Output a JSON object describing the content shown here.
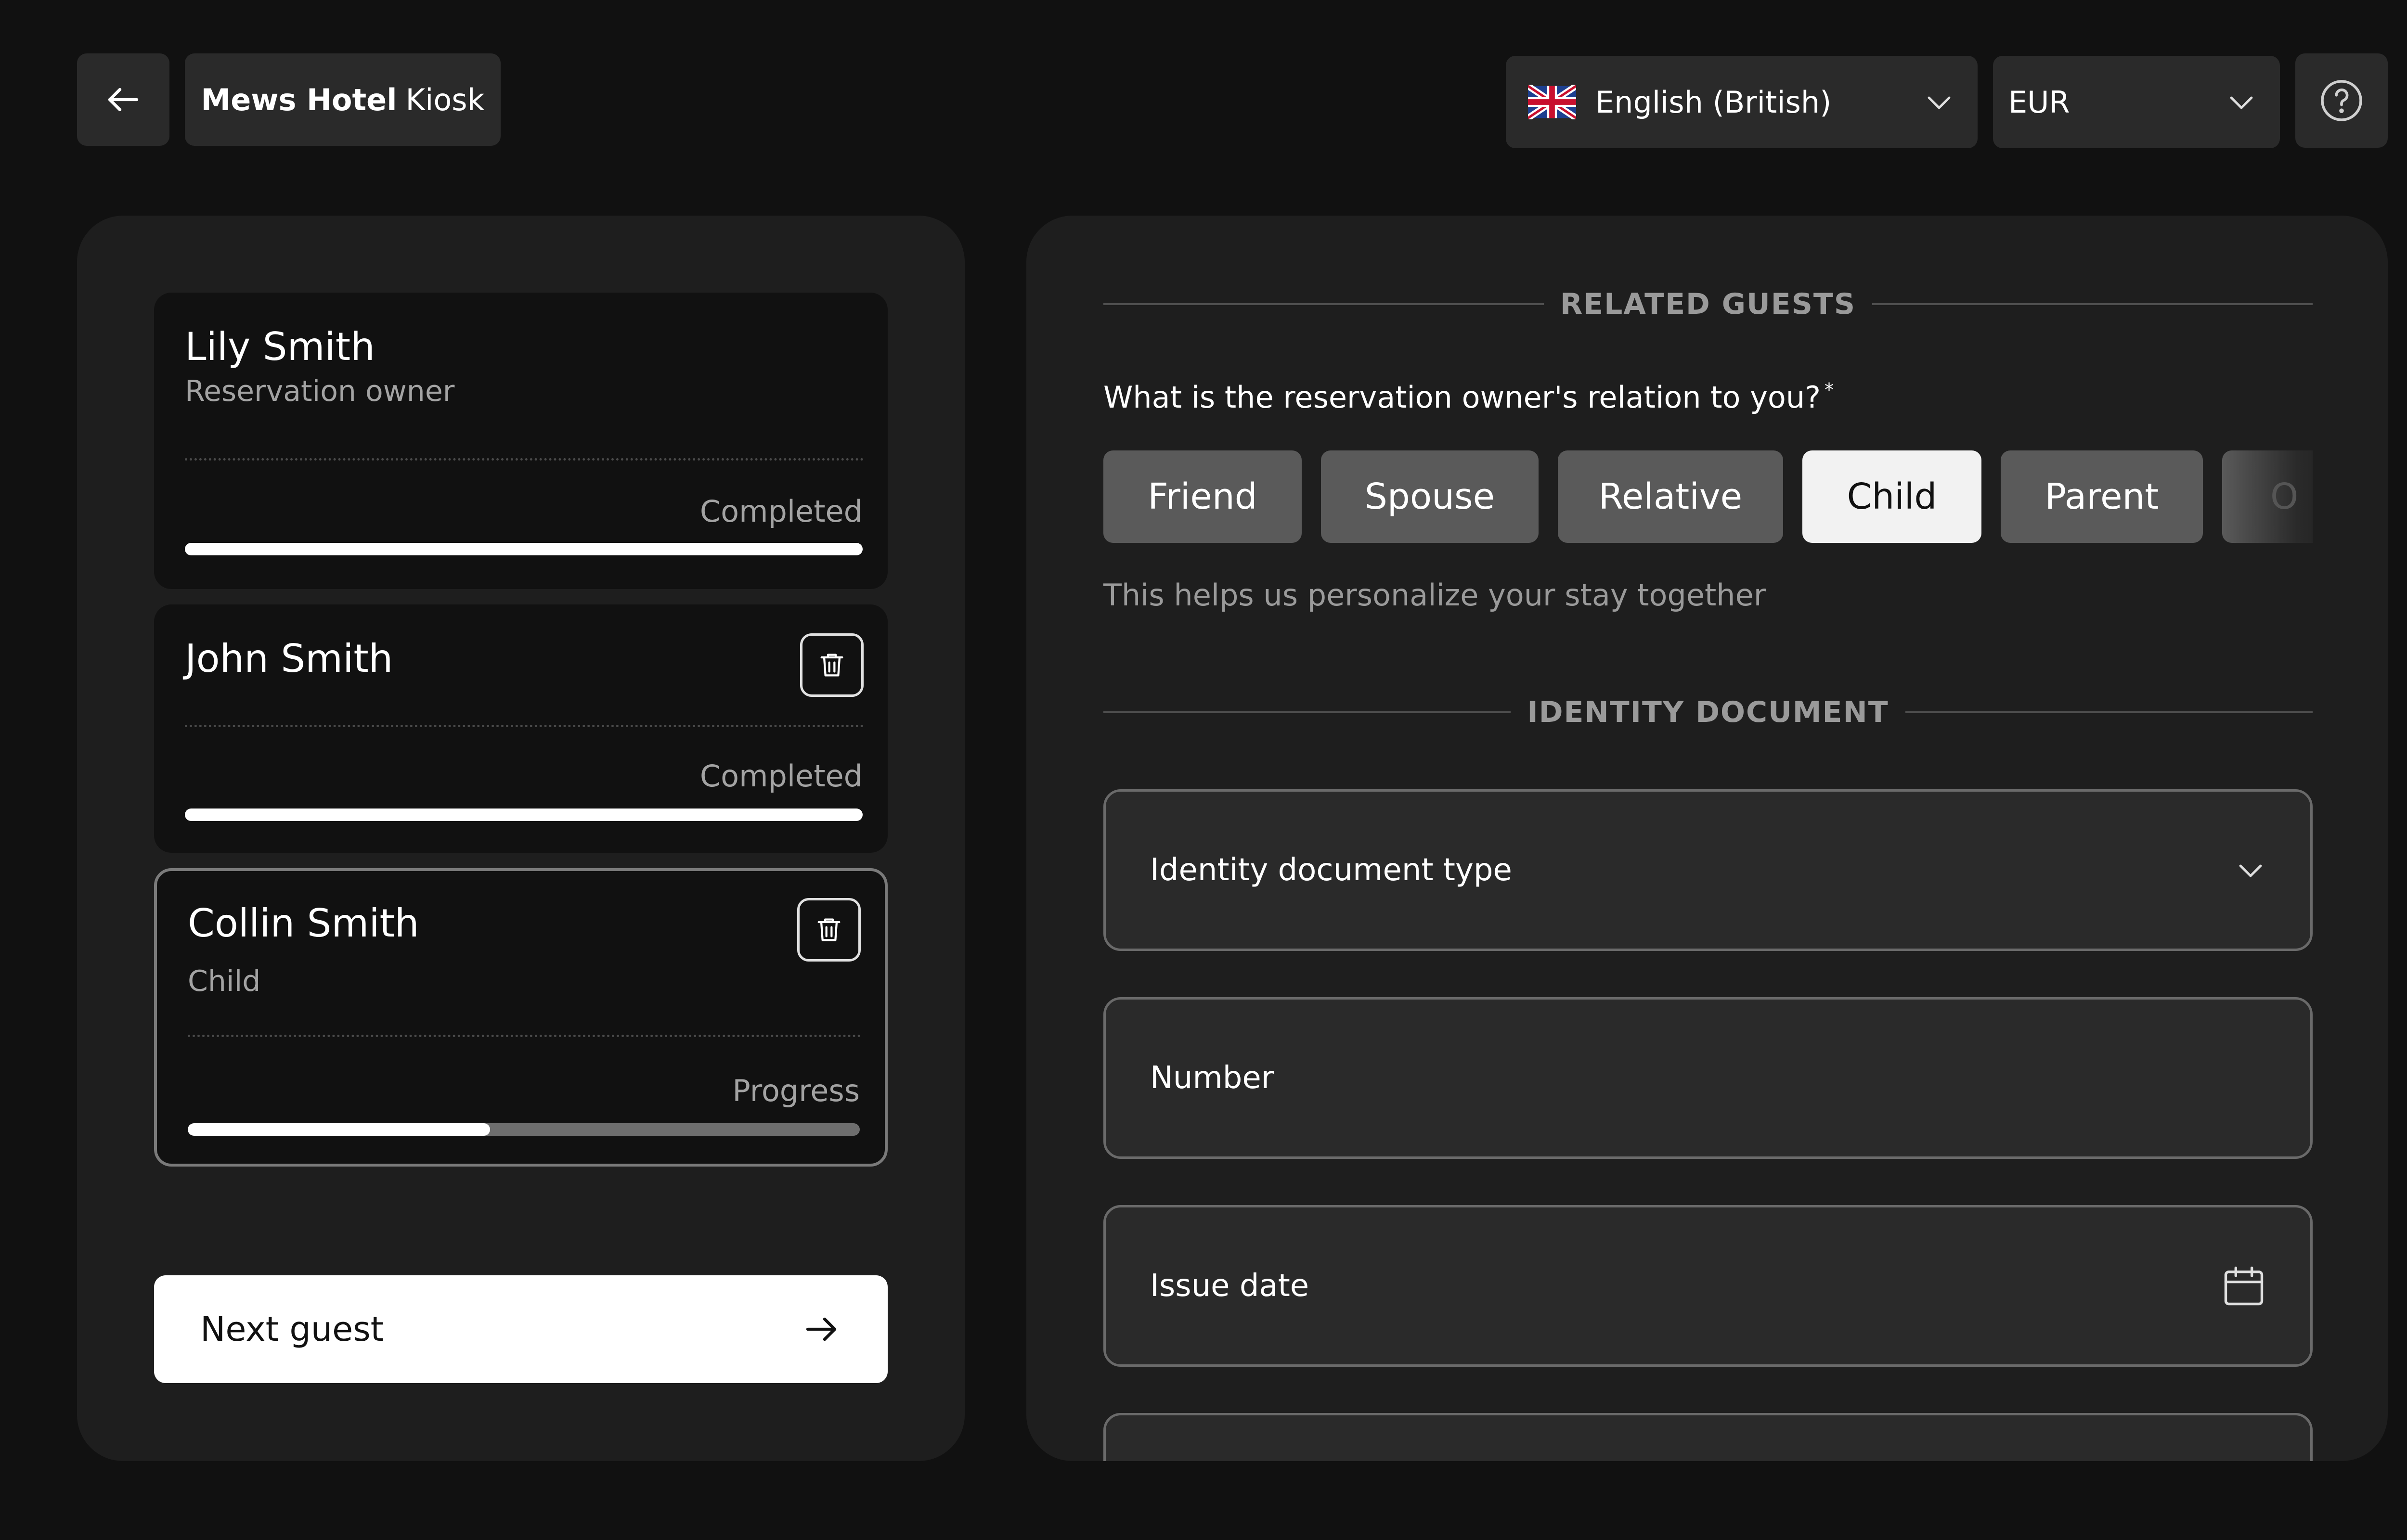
{
  "header": {
    "back_label": "back",
    "app_title_bold": "Mews Hotel",
    "app_title_rest": "Kiosk",
    "language": "English (British)",
    "currency": "EUR"
  },
  "guests": [
    {
      "name": "Lily Smith",
      "role": "Reservation owner",
      "status": "Completed",
      "progress": 1.0
    },
    {
      "name": "John Smith",
      "role": "",
      "status": "Completed",
      "progress": 1.0
    },
    {
      "name": "Collin Smith",
      "role": "Child",
      "status": "Progress",
      "progress": 0.45
    }
  ],
  "next_button": {
    "label": "Next guest"
  },
  "related_guests": {
    "section_title": "RELATED GUESTS",
    "question": "What is the reservation owner's relation to you?",
    "required_mark": "*",
    "options": [
      "Friend",
      "Spouse",
      "Relative",
      "Child",
      "Parent",
      "O"
    ],
    "selected": "Child",
    "hint": "This helps us personalize your stay together"
  },
  "identity_document": {
    "section_title": "IDENTITY DOCUMENT",
    "fields": {
      "type": "Identity document type",
      "number": "Number",
      "issue_date": "Issue date"
    }
  },
  "colors": {
    "background": "#111111",
    "panel": "#1e1e1e",
    "control": "#2a2a2a",
    "chip": "#5a5a5a",
    "chip_selected": "#f2f2f2",
    "accent": "#ffffff"
  }
}
